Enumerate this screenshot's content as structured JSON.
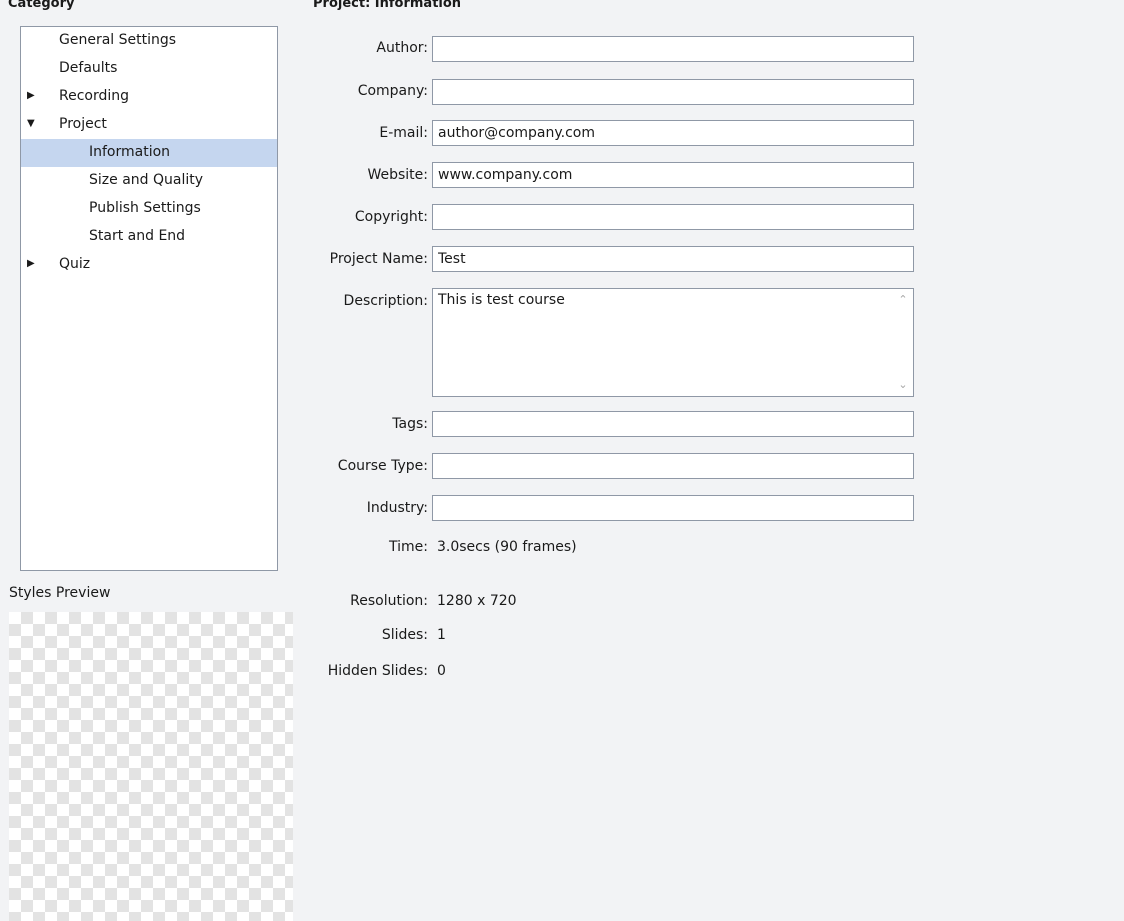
{
  "headings": {
    "category": "Category",
    "project": "Project: Information"
  },
  "tree": {
    "items": [
      {
        "label": "General Settings",
        "arrow": ""
      },
      {
        "label": "Defaults",
        "arrow": ""
      },
      {
        "label": "Recording",
        "arrow": "▶"
      },
      {
        "label": "Project",
        "arrow": "▼"
      },
      {
        "label": "Information",
        "arrow": "",
        "selected": true
      },
      {
        "label": "Size and Quality",
        "arrow": ""
      },
      {
        "label": "Publish Settings",
        "arrow": ""
      },
      {
        "label": "Start and End",
        "arrow": ""
      },
      {
        "label": "Quiz",
        "arrow": "▶"
      }
    ]
  },
  "styles_preview": {
    "label": "Styles Preview"
  },
  "form": {
    "author": {
      "label": "Author:",
      "value": ""
    },
    "company": {
      "label": "Company:",
      "value": ""
    },
    "email": {
      "label": "E-mail:",
      "value": "author@company.com"
    },
    "website": {
      "label": "Website:",
      "value": "www.company.com"
    },
    "copyright": {
      "label": "Copyright:",
      "value": ""
    },
    "project_name": {
      "label": "Project Name:",
      "value": "Test"
    },
    "description": {
      "label": "Description:",
      "value": "This is test course"
    },
    "tags": {
      "label": "Tags:",
      "value": ""
    },
    "course_type": {
      "label": "Course Type:",
      "value": ""
    },
    "industry": {
      "label": "Industry:",
      "value": ""
    }
  },
  "info": {
    "time": {
      "label": "Time:",
      "value": "3.0secs (90 frames)"
    },
    "resolution": {
      "label": "Resolution:",
      "value": "1280 x 720"
    },
    "slides": {
      "label": "Slides:",
      "value": "1"
    },
    "hidden_slides": {
      "label": "Hidden Slides:",
      "value": "0"
    }
  },
  "colors": {
    "selection": "#c5d6ef",
    "background": "#f2f3f5",
    "border": "#8f98a6"
  },
  "icons": {
    "expand": "chevron-right-icon",
    "collapse": "chevron-down-icon",
    "scroll_up": "scroll-up-icon",
    "scroll_down": "scroll-down-icon"
  }
}
